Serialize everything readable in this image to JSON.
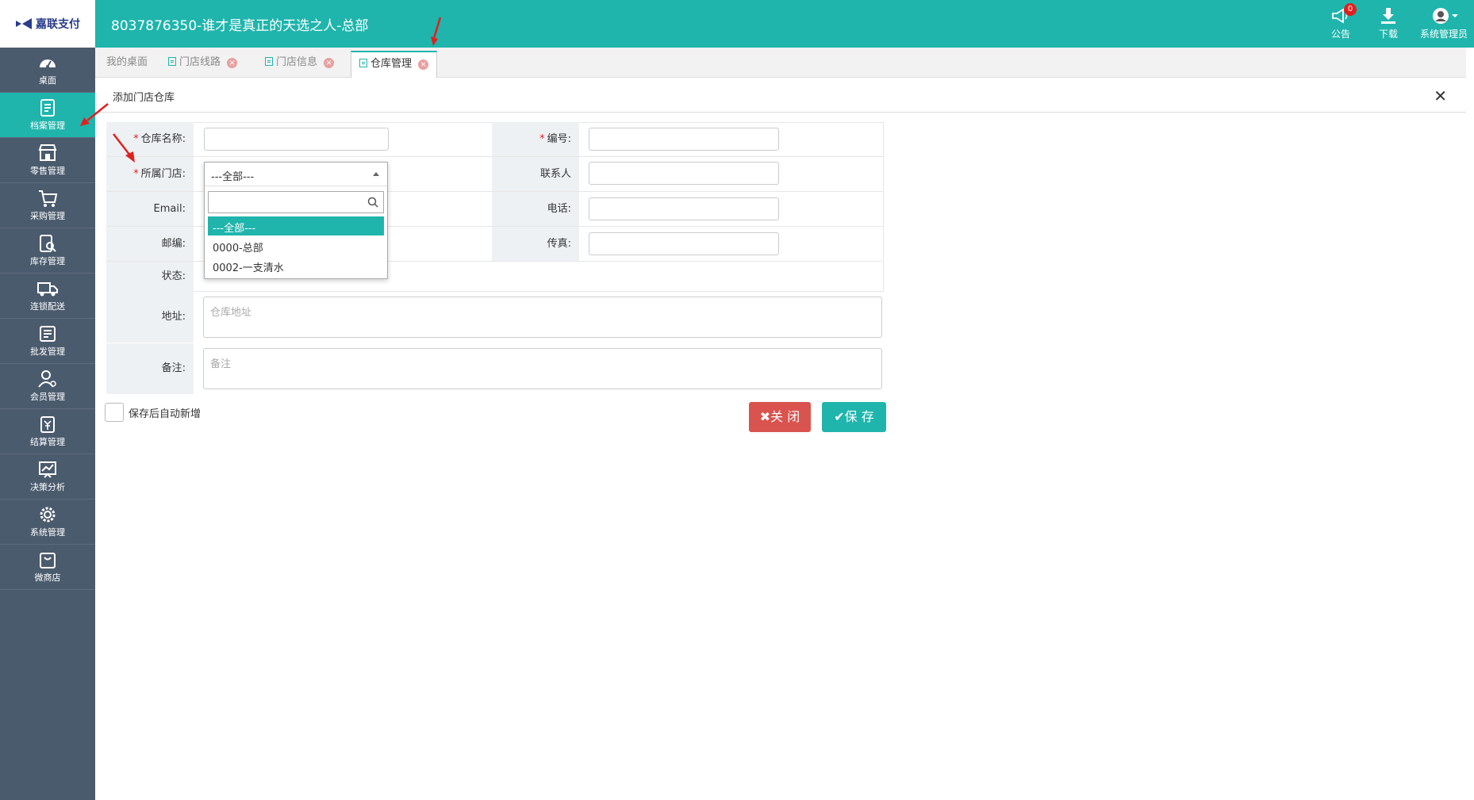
{
  "header": {
    "logo_text": "嘉联支付",
    "title": "8037876350-谁才是真正的天选之人-总部",
    "actions": {
      "notice_label": "公告",
      "notice_badge": "0",
      "download_label": "下载",
      "user_label": "系统管理员"
    }
  },
  "sidebar": {
    "items": [
      {
        "label": "桌面",
        "icon": "dashboard-icon"
      },
      {
        "label": "档案管理",
        "icon": "archive-icon"
      },
      {
        "label": "零售管理",
        "icon": "store-icon"
      },
      {
        "label": "采购管理",
        "icon": "cart-icon"
      },
      {
        "label": "库存管理",
        "icon": "inventory-icon"
      },
      {
        "label": "连锁配送",
        "icon": "truck-icon"
      },
      {
        "label": "批发管理",
        "icon": "wholesale-icon"
      },
      {
        "label": "会员管理",
        "icon": "member-icon"
      },
      {
        "label": "结算管理",
        "icon": "settlement-icon"
      },
      {
        "label": "决策分析",
        "icon": "chart-icon"
      },
      {
        "label": "系统管理",
        "icon": "gear-icon"
      },
      {
        "label": "微商店",
        "icon": "bag-icon"
      }
    ],
    "active_index": 1
  },
  "tabs": [
    {
      "label": "我的桌面"
    },
    {
      "label": "门店线路"
    },
    {
      "label": "门店信息"
    },
    {
      "label": "仓库管理"
    }
  ],
  "panel": {
    "title": "添加门店仓库",
    "close_glyph": "✕"
  },
  "form": {
    "warehouse_name_label": "仓库名称:",
    "code_label": "编号:",
    "store_label": "所属门店:",
    "contact_label": "联系人",
    "email_label": "Email:",
    "phone_label": "电话:",
    "zip_label": "邮编:",
    "fax_label": "传真:",
    "status_label": "状态:",
    "address_label": "地址:",
    "address_placeholder": "仓库地址",
    "remark_label": "备注:",
    "remark_placeholder": "备注"
  },
  "dropdown": {
    "current": "---全部---",
    "options": [
      "---全部---",
      "0000-总部",
      "0002-一支清水"
    ]
  },
  "footer": {
    "auto_add_label": "保存后自动新增",
    "close_button": "关 闭",
    "save_button": "保 存"
  },
  "colors": {
    "brand": "#1fb5ac",
    "sidebar": "#4b5b6e",
    "danger": "#d9534f"
  }
}
